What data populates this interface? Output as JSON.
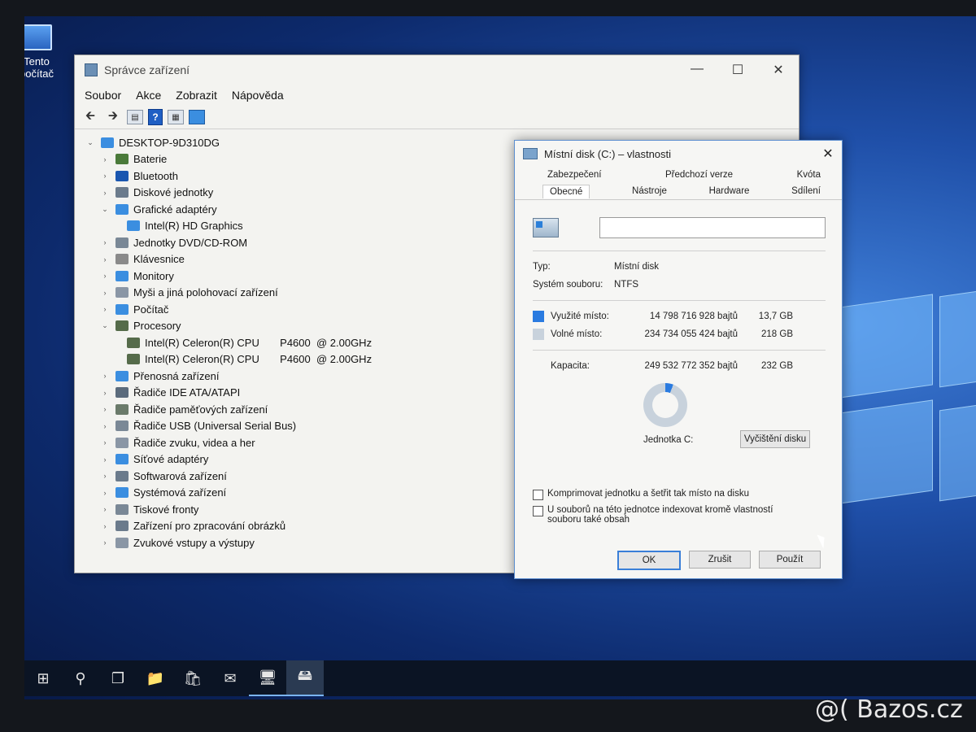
{
  "desktop": {
    "icon_label": "Tento počítač"
  },
  "device_manager": {
    "title": "Správce zařízení",
    "menu": [
      "Soubor",
      "Akce",
      "Zobrazit",
      "Nápověda"
    ],
    "tree": {
      "root": "DESKTOP-9D310DG",
      "items": [
        {
          "label": "Baterie",
          "level": 1,
          "expander": "›",
          "icon_color": "#4a7a3a"
        },
        {
          "label": "Bluetooth",
          "level": 1,
          "expander": "›",
          "icon_color": "#1a56b0"
        },
        {
          "label": "Diskové jednotky",
          "level": 1,
          "expander": "›",
          "icon_color": "#6b7b8c"
        },
        {
          "label": "Grafické adaptéry",
          "level": 1,
          "expander": "⌄",
          "icon_color": "#3b8ee0"
        },
        {
          "label": "Intel(R) HD Graphics",
          "level": 2,
          "expander": "",
          "icon_color": "#3b8ee0"
        },
        {
          "label": "Jednotky DVD/CD-ROM",
          "level": 1,
          "expander": "›",
          "icon_color": "#7a8896"
        },
        {
          "label": "Klávesnice",
          "level": 1,
          "expander": "›",
          "icon_color": "#8a8a8a"
        },
        {
          "label": "Monitory",
          "level": 1,
          "expander": "›",
          "icon_color": "#3b8ee0"
        },
        {
          "label": "Myši a jiná polohovací zařízení",
          "level": 1,
          "expander": "›",
          "icon_color": "#8a96a5"
        },
        {
          "label": "Počítač",
          "level": 1,
          "expander": "›",
          "icon_color": "#3b8ee0"
        },
        {
          "label": "Procesory",
          "level": 1,
          "expander": "⌄",
          "icon_color": "#556b4a"
        },
        {
          "label": "Intel(R) Celeron(R) CPU       P4600  @ 2.00GHz",
          "level": 2,
          "expander": "",
          "icon_color": "#556b4a"
        },
        {
          "label": "Intel(R) Celeron(R) CPU       P4600  @ 2.00GHz",
          "level": 2,
          "expander": "",
          "icon_color": "#556b4a"
        },
        {
          "label": "Přenosná zařízení",
          "level": 1,
          "expander": "›",
          "icon_color": "#3b8ee0"
        },
        {
          "label": "Řadiče IDE ATA/ATAPI",
          "level": 1,
          "expander": "›",
          "icon_color": "#5b6b7c"
        },
        {
          "label": "Řadiče paměťových zařízení",
          "level": 1,
          "expander": "›",
          "icon_color": "#6a7a6a"
        },
        {
          "label": "Řadiče USB (Universal Serial Bus)",
          "level": 1,
          "expander": "›",
          "icon_color": "#7a8896"
        },
        {
          "label": "Řadiče zvuku, videa a her",
          "level": 1,
          "expander": "›",
          "icon_color": "#8a96a5"
        },
        {
          "label": "Síťové adaptéry",
          "level": 1,
          "expander": "›",
          "icon_color": "#3b8ee0"
        },
        {
          "label": "Softwarová zařízení",
          "level": 1,
          "expander": "›",
          "icon_color": "#6b7b8c"
        },
        {
          "label": "Systémová zařízení",
          "level": 1,
          "expander": "›",
          "icon_color": "#3b8ee0"
        },
        {
          "label": "Tiskové fronty",
          "level": 1,
          "expander": "›",
          "icon_color": "#7a8896"
        },
        {
          "label": "Zařízení pro zpracování obrázků",
          "level": 1,
          "expander": "›",
          "icon_color": "#6b7b8c"
        },
        {
          "label": "Zvukové vstupy a výstupy",
          "level": 1,
          "expander": "›",
          "icon_color": "#8a96a5"
        }
      ]
    }
  },
  "properties": {
    "title": "Místní disk (C:) – vlastnosti",
    "tabs_row1": [
      "Zabezpečení",
      "Předchozí verze",
      "Kvóta"
    ],
    "tabs_row2": [
      "Obecné",
      "Nástroje",
      "Hardware",
      "Sdílení"
    ],
    "active_tab": "Obecné",
    "name_value": "",
    "type_label": "Typ:",
    "type_value": "Místní disk",
    "fs_label": "Systém souboru:",
    "fs_value": "NTFS",
    "used": {
      "label": "Využité místo:",
      "bytes": "14 798 716 928 bajtů",
      "size": "13,7 GB",
      "color": "#2a7be0"
    },
    "free": {
      "label": "Volné místo:",
      "bytes": "234 734 055 424 bajtů",
      "size": "218 GB",
      "color": "#c8d2dc"
    },
    "capacity": {
      "label": "Kapacita:",
      "bytes": "249 532 772 352 bajtů",
      "size": "232 GB"
    },
    "used_fraction": 0.059,
    "drive_label": "Jednotka C:",
    "cleanup_button": "Vyčištění disku",
    "compress_checkbox": "Komprimovat jednotku a šetřit tak místo na disku",
    "index_checkbox": "U souborů na této jednotce indexovat kromě vlastností souboru také obsah",
    "ok_button": "OK",
    "cancel_button": "Zrušit",
    "apply_button": "Použít"
  },
  "taskbar": {
    "items": [
      "start-icon",
      "search-icon",
      "task-view-icon",
      "file-explorer-icon",
      "store-icon",
      "mail-icon",
      "device-manager-icon",
      "disk-properties-icon"
    ]
  },
  "watermark": "@( Bazos.cz"
}
